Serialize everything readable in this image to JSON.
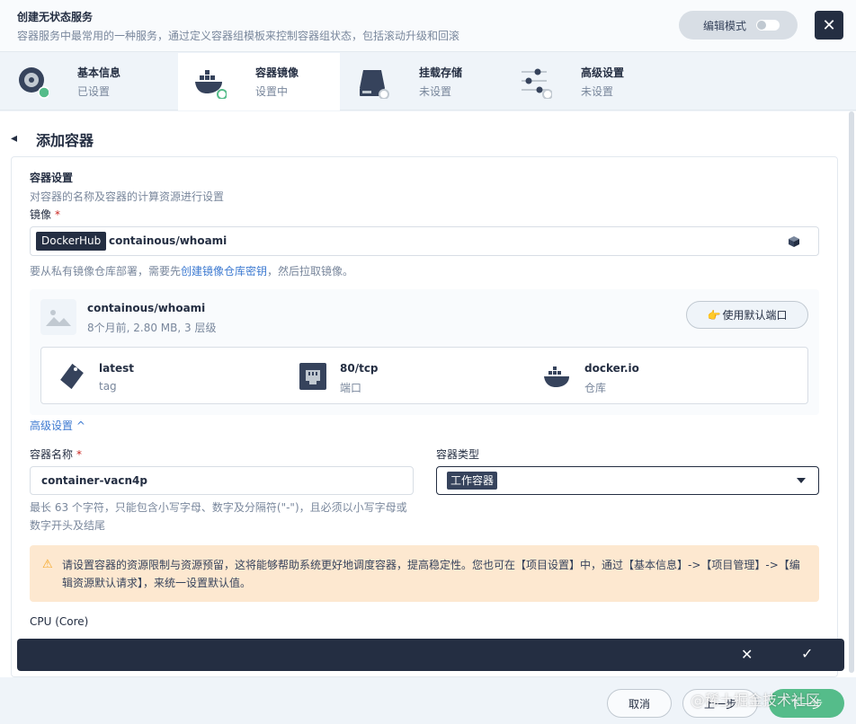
{
  "header": {
    "title": "创建无状态服务",
    "description": "容器服务中最常用的一种服务，通过定义容器组模板来控制容器组状态，包括滚动升级和回滚",
    "edit_mode_label": "编辑模式",
    "close_glyph": "✕"
  },
  "steps": [
    {
      "label": "基本信息",
      "status": "已设置",
      "icon": "disc-icon"
    },
    {
      "label": "容器镜像",
      "status": "设置中",
      "icon": "docker-icon"
    },
    {
      "label": "挂载存储",
      "status": "未设置",
      "icon": "disk-icon"
    },
    {
      "label": "高级设置",
      "status": "未设置",
      "icon": "sliders-icon"
    }
  ],
  "page": {
    "back_glyph": "◂",
    "title": "添加容器"
  },
  "container_settings": {
    "title": "容器设置",
    "description": "对容器的名称及容器的计算资源进行设置",
    "image_label": "镜像",
    "required_mark": "*",
    "registry": "DockerHub",
    "image_value": "containous/whoami",
    "hint_prefix": "要从私有镜像仓库部署，需要先",
    "hint_link": "创建镜像仓库密钥",
    "hint_suffix": "，然后拉取镜像。"
  },
  "image_info": {
    "name": "containous/whoami",
    "meta": "8个月前, 2.80 MB, 3 层级",
    "default_port_button": "使用默认端口",
    "items": [
      {
        "value": "latest",
        "key": "tag",
        "icon": "tag-icon"
      },
      {
        "value": "80/tcp",
        "key": "端口",
        "icon": "port-icon"
      },
      {
        "value": "docker.io",
        "key": "仓库",
        "icon": "docker-icon"
      }
    ]
  },
  "advanced": {
    "link_label": "高级设置 ^"
  },
  "container_name": {
    "label": "容器名称",
    "required_mark": "*",
    "value": "container-vacn4p",
    "hint": "最长 63 个字符，只能包含小写字母、数字及分隔符(\"-\")，且必须以小写字母或数字开头及结尾"
  },
  "container_type": {
    "label": "容器类型",
    "value": "工作容器"
  },
  "warning": {
    "icon_glyph": "⚠",
    "text": "请设置容器的资源限制与资源预留，这将能够帮助系统更好地调度容器，提高稳定性。您也可在【项目设置】中，通过【基本信息】->【项目管理】->【编辑资源默认请求】，来统一设置默认值。"
  },
  "cpu": {
    "label": "CPU (Core)"
  },
  "action_bar": {
    "cancel_glyph": "✕",
    "confirm_glyph": "✓"
  },
  "footer": {
    "cancel": "取消",
    "prev": "上一步",
    "next": "下一步",
    "watermark": "@稀土掘金技术社区"
  },
  "colors": {
    "primary_dark": "#242e42",
    "success": "#55bc8a",
    "link": "#3d7ad1",
    "warning_bg": "#fde8d0",
    "required": "#ca2621"
  }
}
